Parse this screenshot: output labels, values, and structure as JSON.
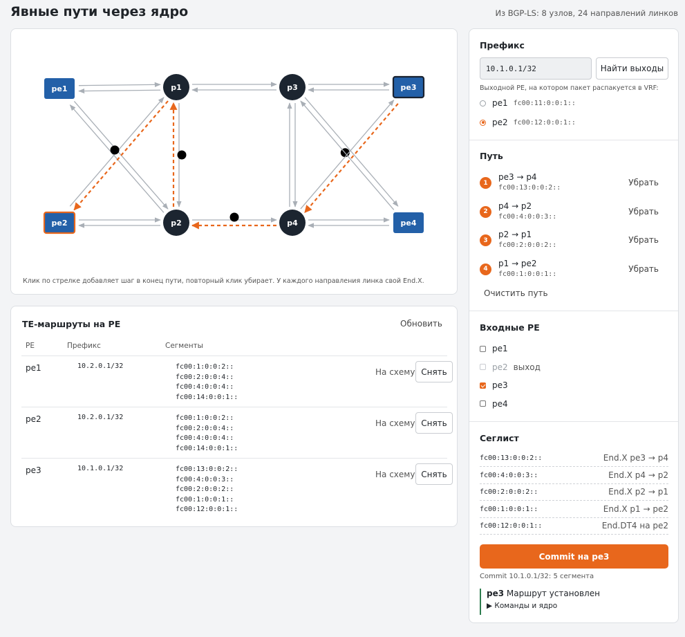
{
  "header": {
    "title": "Явные пути через ядро",
    "stats": "Из BGP-LS: 8 узлов, 24 направлений линков"
  },
  "graph": {
    "nodes": [
      {
        "id": "pe1",
        "label": "pe1",
        "kind": "pe",
        "state": "normal"
      },
      {
        "id": "p1",
        "label": "p1",
        "kind": "p",
        "state": "normal"
      },
      {
        "id": "p3",
        "label": "p3",
        "kind": "p",
        "state": "normal"
      },
      {
        "id": "pe3",
        "label": "pe3",
        "kind": "pe",
        "state": "ingress"
      },
      {
        "id": "pe2",
        "label": "pe2",
        "kind": "pe",
        "state": "egress"
      },
      {
        "id": "p2",
        "label": "p2",
        "kind": "p",
        "state": "normal"
      },
      {
        "id": "p4",
        "label": "p4",
        "kind": "p",
        "state": "normal"
      },
      {
        "id": "pe4",
        "label": "pe4",
        "kind": "pe",
        "state": "normal"
      }
    ],
    "path_links": [
      "pe3-p4",
      "p4-p2",
      "p2-p1",
      "p1-pe2"
    ],
    "hint": "Клик по стрелке добавляет шаг в конец пути, повторный клик убирает. У каждого направления линка свой End.X."
  },
  "routes": {
    "title": "TE-маршруты на PE",
    "refresh_label": "Обновить",
    "columns": [
      "PE",
      "Префикс",
      "Сегменты"
    ],
    "rows": [
      {
        "pe": "pe1",
        "prefix": "10.2.0.1/32",
        "segments": [
          "fc00:1:0:0:2::",
          "fc00:2:0:0:4::",
          "fc00:4:0:0:4::",
          "fc00:14:0:0:1::"
        ],
        "to_scheme": "На схему",
        "remove": "Снять"
      },
      {
        "pe": "pe2",
        "prefix": "10.2.0.1/32",
        "segments": [
          "fc00:1:0:0:2::",
          "fc00:2:0:0:4::",
          "fc00:4:0:0:4::",
          "fc00:14:0:0:1::"
        ],
        "to_scheme": "На схему",
        "remove": "Снять"
      },
      {
        "pe": "pe3",
        "prefix": "10.1.0.1/32",
        "segments": [
          "fc00:13:0:0:2::",
          "fc00:4:0:0:3::",
          "fc00:2:0:0:2::",
          "fc00:1:0:0:1::",
          "fc00:12:0:0:1::"
        ],
        "to_scheme": "На схему",
        "remove": "Снять"
      }
    ]
  },
  "prefix_section": {
    "title": "Префикс",
    "value": "10.1.0.1/32",
    "find_button": "Найти выходы",
    "exit_hint": "Выходной PE, на котором пакет распакуется в VRF:",
    "exits": [
      {
        "name": "pe1",
        "address": "fc00:11:0:0:1::",
        "selected": false
      },
      {
        "name": "pe2",
        "address": "fc00:12:0:0:1::",
        "selected": true
      }
    ]
  },
  "path_section": {
    "title": "Путь",
    "steps": [
      {
        "num": "1",
        "hop": "pe3 → p4",
        "sid": "fc00:13:0:0:2::",
        "remove": "Убрать"
      },
      {
        "num": "2",
        "hop": "p4 → p2",
        "sid": "fc00:4:0:0:3::",
        "remove": "Убрать"
      },
      {
        "num": "3",
        "hop": "p2 → p1",
        "sid": "fc00:2:0:0:2::",
        "remove": "Убрать"
      },
      {
        "num": "4",
        "hop": "p1 → pe2",
        "sid": "fc00:1:0:0:1::",
        "remove": "Убрать"
      }
    ],
    "clear": "Очистить путь"
  },
  "ingress_section": {
    "title": "Входные PE",
    "items": [
      {
        "name": "pe1",
        "checked": false,
        "disabled": false,
        "tag": ""
      },
      {
        "name": "pe2",
        "checked": false,
        "disabled": true,
        "tag": "выход"
      },
      {
        "name": "pe3",
        "checked": true,
        "disabled": false,
        "tag": ""
      },
      {
        "name": "pe4",
        "checked": false,
        "disabled": false,
        "tag": ""
      }
    ]
  },
  "seglist_section": {
    "title": "Сеглист",
    "items": [
      {
        "sid": "fc00:13:0:0:2::",
        "desc": "End.X pe3 → p4"
      },
      {
        "sid": "fc00:4:0:0:3::",
        "desc": "End.X p4 → p2"
      },
      {
        "sid": "fc00:2:0:0:2::",
        "desc": "End.X p2 → p1"
      },
      {
        "sid": "fc00:1:0:0:1::",
        "desc": "End.X p1 → pe2"
      },
      {
        "sid": "fc00:12:0:0:1::",
        "desc": "End.DT4 на pe2"
      }
    ]
  },
  "commit": {
    "button": "Commit на pe3",
    "summary": "Commit 10.1.0.1/32: 5 сегмента",
    "status_node": "pe3",
    "status_text": "Маршрут установлен",
    "details": "Команды и ядро"
  },
  "colors": {
    "accent": "#e8671c",
    "pe_node": "#2360a8",
    "p_node": "#1c2530",
    "link": "#a9afb6",
    "success": "#2e7d4f"
  }
}
